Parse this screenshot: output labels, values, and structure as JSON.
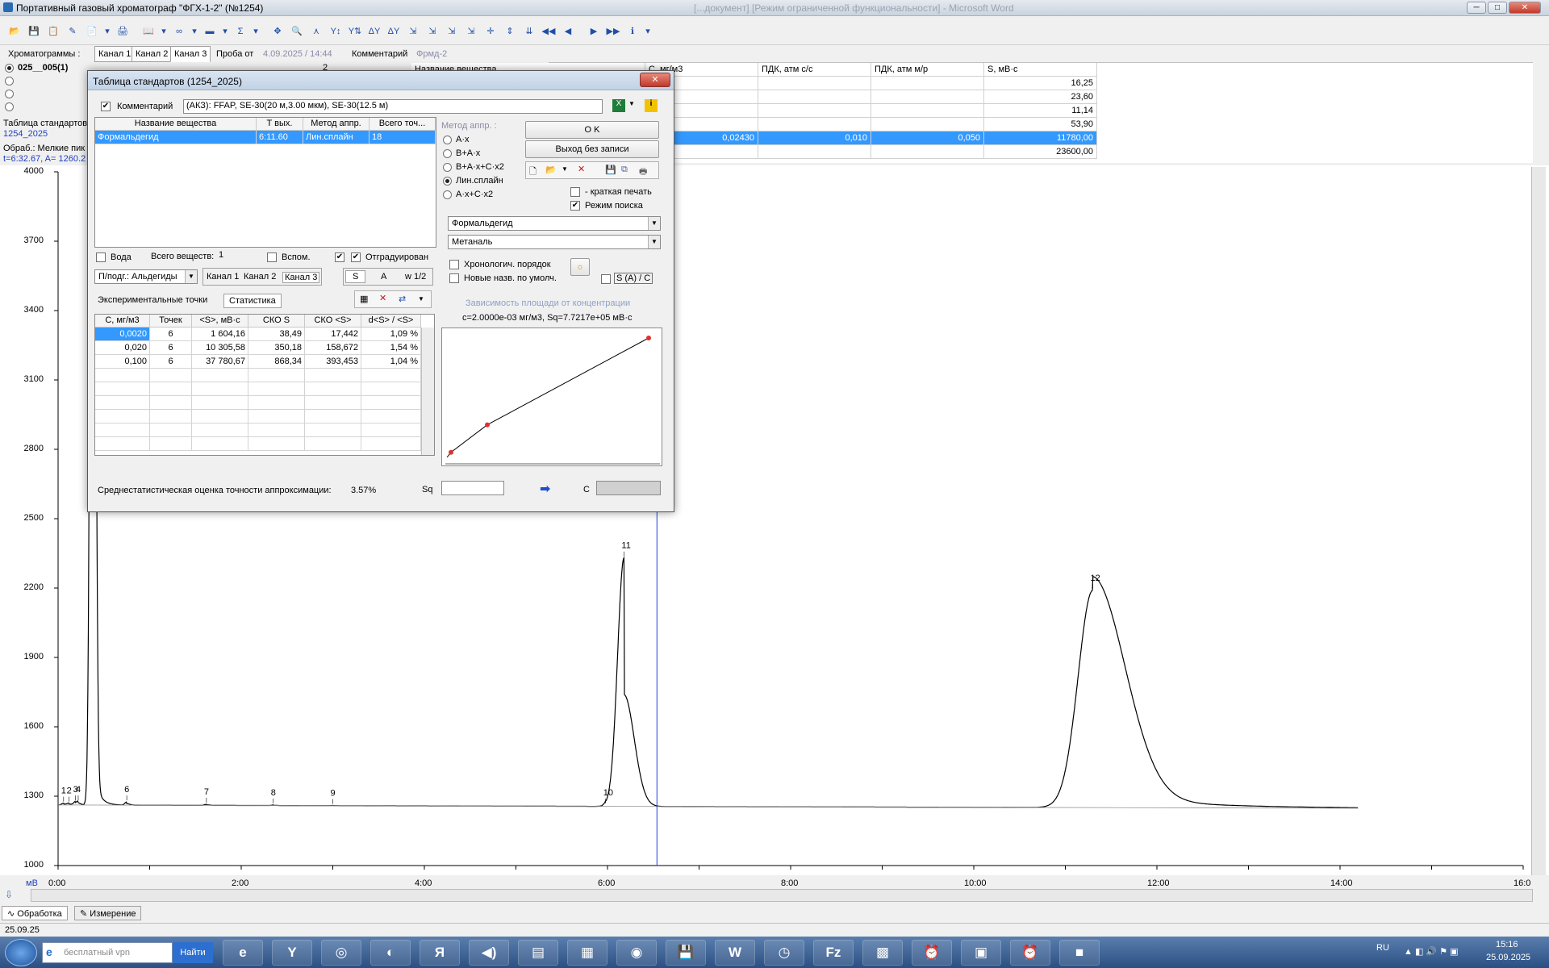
{
  "window": {
    "title": "Портативный газовый хроматограф \"ФГХ-1-2\" (№1254)",
    "ghost_title": "[...документ] [Режим ограниченной функциональности] - Microsoft Word",
    "min": "─",
    "max": "□",
    "close": "✕"
  },
  "toolbar": {
    "buttons": [
      "📂",
      "💾",
      "📋",
      "✎",
      "📄",
      "▾",
      "🖨",
      "📖",
      "▾",
      "∞",
      "▾",
      "▬",
      "▾",
      "Σ",
      "▾",
      "✥",
      "🔍",
      "⋏",
      "Y↕",
      "Y⇅",
      "ΔY",
      "ΔY",
      "⇲",
      "⇲",
      "⇲",
      "⇲",
      "✛",
      "⇕",
      "⇊",
      "◀◀",
      "◀",
      "▶",
      "▶▶",
      "ℹ",
      "▾"
    ]
  },
  "header": {
    "chromatograms_label": "Хроматограммы :",
    "channels": [
      "Канал 1",
      "Канал 2",
      "Канал 3"
    ],
    "sample_label": "Проба от",
    "sample_value": "4.09.2025 / 14:44",
    "comment_label": "Комментарий",
    "comment_value": "Фрмд-2"
  },
  "left": {
    "items": [
      "025__005(1)",
      "",
      "",
      ""
    ],
    "std_table_label": "Таблица стандартов",
    "std_table_value": "1254_2025",
    "processing": "Обраб.: Мелкие пик",
    "coords": "t=6:32.67, A= 1260.2"
  },
  "grid": {
    "headers": [
      "Название вещества",
      "C, мг/м3",
      "ПДК, атм с/с",
      "ПДК, атм м/р",
      "S, мВ·с"
    ],
    "top_hdr_extra": [
      "2"
    ],
    "rows": [
      [
        "",
        "",
        "",
        "",
        "16,25"
      ],
      [
        "",
        "",
        "",
        "",
        "23,60"
      ],
      [
        "",
        "",
        "",
        "",
        "11,14"
      ],
      [
        "",
        "",
        "",
        "",
        "53,90"
      ],
      [
        "",
        "0,02430",
        "0,010",
        "0,050",
        "11780,00"
      ],
      [
        "",
        "",
        "",
        "",
        "23600,00"
      ]
    ]
  },
  "chart_data": {
    "type": "line",
    "xlabel": "",
    "ylabel": "мВ",
    "y_ticks": [
      "4000",
      "3700",
      "3400",
      "3100",
      "2800",
      "2500",
      "2200",
      "1900",
      "1600",
      "1300",
      "1000"
    ],
    "x_ticks": [
      "0:00",
      "2:00",
      "4:00",
      "6:00",
      "8:00",
      "10:00",
      "12:00",
      "14:00",
      "16:0"
    ],
    "ylim": [
      1000,
      4000
    ],
    "xlim_min": [
      0,
      16
    ],
    "peaks": [
      {
        "label": "1",
        "t": 0.06,
        "h": 1270
      },
      {
        "label": "2",
        "t": 0.12,
        "h": 1270
      },
      {
        "label": "3",
        "t": 0.19,
        "h": 1275
      },
      {
        "label": "4",
        "t": 0.22,
        "h": 1275
      },
      {
        "label": "6",
        "t": 0.75,
        "h": 1275
      },
      {
        "label": "7",
        "t": 1.62,
        "h": 1265
      },
      {
        "label": "8",
        "t": 2.35,
        "h": 1262
      },
      {
        "label": "9",
        "t": 3.0,
        "h": 1260
      },
      {
        "label": "10",
        "t": 5.98,
        "h": 1262
      },
      {
        "label": "11",
        "t": 6.18,
        "h": 2330
      },
      {
        "label": "12",
        "t": 11.3,
        "h": 2190
      }
    ],
    "cursor_t": 6.54
  },
  "dialog": {
    "title": "Таблица стандартов (1254_2025)",
    "close": "✕",
    "comment_label": "Комментарий",
    "comment_value": "(АКЗ): FFAP, SE-30(20 м,3.00 мкм), SE-30(12.5 м)",
    "sub_headers": [
      "Название вещества",
      "T вых.",
      "Метод аппр.",
      "Всего точ..."
    ],
    "sub_row": [
      "Формальдегид",
      "6:11.60",
      "Лин.сплайн",
      "18"
    ],
    "method_label": "Метод аппр. :",
    "methods": [
      "A·x",
      "B+A·x",
      "B+A·x+C·x2",
      "Лин.сплайн",
      "A·x+C·x2"
    ],
    "ok": "O K",
    "exit": "Выход без записи",
    "short_print": "- краткая печать",
    "search_mode": "Режим поиска",
    "substance": "Формальдегид",
    "synonym": "Метаналь",
    "chrono": "Хронологич. порядок",
    "new_names": "Новые назв. по умолч.",
    "s_ratio": "S (A) / C",
    "water": "Вода",
    "total_label": "Всего веществ:",
    "total_value": "1",
    "aux": "Вспом.",
    "calibrated": "Отградуирован",
    "subgroup": "П/подг.: Альдегиды",
    "channels": [
      "Канал 1",
      "Канал 2",
      "Канал 3"
    ],
    "s_btn": "S",
    "a_btn": "A",
    "w_btn": "w 1/2",
    "tab_exp": "Экспериментальные точки",
    "tab_stat": "Статистика",
    "table_headers": [
      "C, мг/м3",
      "Точек",
      "<S>, мВ·с",
      "СКО S",
      "СКО <S>",
      "d<S> / <S>"
    ],
    "table_rows": [
      [
        "0,0020",
        "6",
        "1 604,16",
        "38,49",
        "17,442",
        "1,09 %"
      ],
      [
        "0,020",
        "6",
        "10 305,58",
        "350,18",
        "158,672",
        "1,54 %"
      ],
      [
        "0,100",
        "6",
        "37 780,67",
        "868,34",
        "393,453",
        "1,04 %"
      ]
    ],
    "dep_title": "Зависимость площади от концентрации",
    "dep_formula": "c=2.0000e-03 мг/м3,  Sq=7.7217e+05 мВ·с",
    "accuracy_label": "Среднестатистическая оценка точности аппроксимации:",
    "accuracy_value": "3.57%",
    "sq_label": "Sq",
    "c_label": "C"
  },
  "calib_chart": {
    "type": "line",
    "points": [
      [
        0.002,
        1604.16
      ],
      [
        0.02,
        10305.58
      ],
      [
        0.1,
        37780.67
      ]
    ]
  },
  "bottom_tabs": [
    "Обработка",
    "Измерение"
  ],
  "status": "25.09.25",
  "taskbar": {
    "search_placeholder": "бесплатный vpn",
    "search_btn": "Найти",
    "lang": "RU",
    "time": "15:16",
    "date": "25.09.2025",
    "apps": [
      "e",
      "Y",
      "◎",
      "◐",
      "Я",
      "◀)",
      "▤",
      "▦",
      "◉",
      "💾",
      "W",
      "◷",
      "Fz",
      "▩",
      "⏰",
      "▣",
      "⏰",
      "■"
    ]
  }
}
